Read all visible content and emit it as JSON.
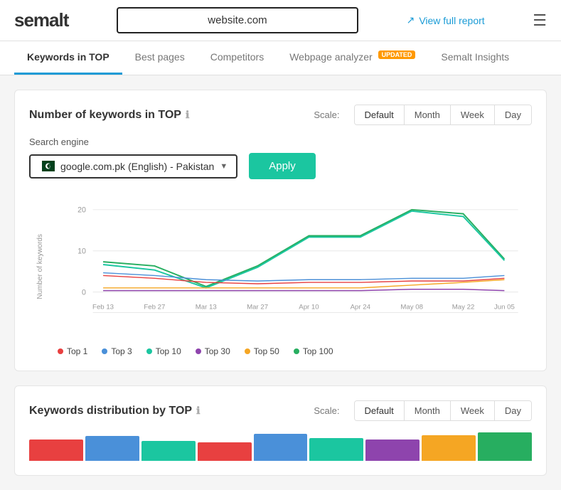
{
  "header": {
    "logo": "semalt",
    "search_placeholder": "website.com",
    "search_value": "website.com",
    "view_full_report": "View full report"
  },
  "nav": {
    "tabs": [
      {
        "id": "keywords-top",
        "label": "Keywords in TOP",
        "active": true,
        "badge": null
      },
      {
        "id": "best-pages",
        "label": "Best pages",
        "active": false,
        "badge": null
      },
      {
        "id": "competitors",
        "label": "Competitors",
        "active": false,
        "badge": null
      },
      {
        "id": "webpage-analyzer",
        "label": "Webpage analyzer",
        "active": false,
        "badge": "UPDATED"
      },
      {
        "id": "semalt-insights",
        "label": "Semalt Insights",
        "active": false,
        "badge": null
      }
    ]
  },
  "card1": {
    "title": "Number of keywords in TOP",
    "scale_label": "Scale:",
    "scale_buttons": [
      "Default",
      "Month",
      "Week",
      "Day"
    ],
    "active_scale": "Default",
    "search_engine_label": "Search engine",
    "search_engine_value": "google.com.pk (English) - Pakistan",
    "apply_label": "Apply",
    "chart": {
      "y_label": "Number of keywords",
      "y_max": 20,
      "y_ticks": [
        0,
        10,
        20
      ],
      "x_labels": [
        "Feb 13",
        "Feb 27",
        "Mar 13",
        "Mar 27",
        "Apr 10",
        "Apr 24",
        "May 08",
        "May 22",
        "Jun 05"
      ],
      "lines": [
        {
          "id": "top1",
          "label": "Top 1",
          "color": "#e84040",
          "data": [
            5,
            4,
            3,
            2,
            3,
            3,
            3,
            3,
            4
          ]
        },
        {
          "id": "top3",
          "label": "Top 3",
          "color": "#4a90d9",
          "data": [
            6,
            5,
            4,
            3,
            4,
            4,
            4,
            4,
            5
          ]
        },
        {
          "id": "top10",
          "label": "Top 10",
          "color": "#1bc6a0",
          "data": [
            8,
            6,
            3,
            5,
            11,
            11,
            20,
            17,
            9
          ]
        },
        {
          "id": "top30",
          "label": "Top 30",
          "color": "#8e44ad",
          "data": [
            1,
            1,
            1,
            1,
            1,
            1,
            2,
            2,
            1
          ]
        },
        {
          "id": "top50",
          "label": "Top 50",
          "color": "#f5a623",
          "data": [
            2,
            2,
            2,
            2,
            2,
            2,
            3,
            4,
            5
          ]
        },
        {
          "id": "top100",
          "label": "Top 100",
          "color": "#1bc6a0",
          "data": [
            7,
            6,
            3,
            5,
            11,
            11,
            20,
            16,
            9
          ]
        }
      ]
    },
    "legend": [
      {
        "label": "Top 1",
        "color": "#e84040"
      },
      {
        "label": "Top 3",
        "color": "#4a90d9"
      },
      {
        "label": "Top 10",
        "color": "#1bc6a0"
      },
      {
        "label": "Top 30",
        "color": "#8e44ad"
      },
      {
        "label": "Top 50",
        "color": "#f5a623"
      },
      {
        "label": "Top 100",
        "color": "#27ae60"
      }
    ]
  },
  "card2": {
    "title": "Keywords distribution by TOP",
    "scale_label": "Scale:",
    "scale_buttons": [
      "Default",
      "Month",
      "Week",
      "Day"
    ],
    "active_scale": "Default"
  },
  "colors": {
    "accent": "#1bc6a0",
    "link": "#1a9bd6",
    "badge": "#f90"
  }
}
